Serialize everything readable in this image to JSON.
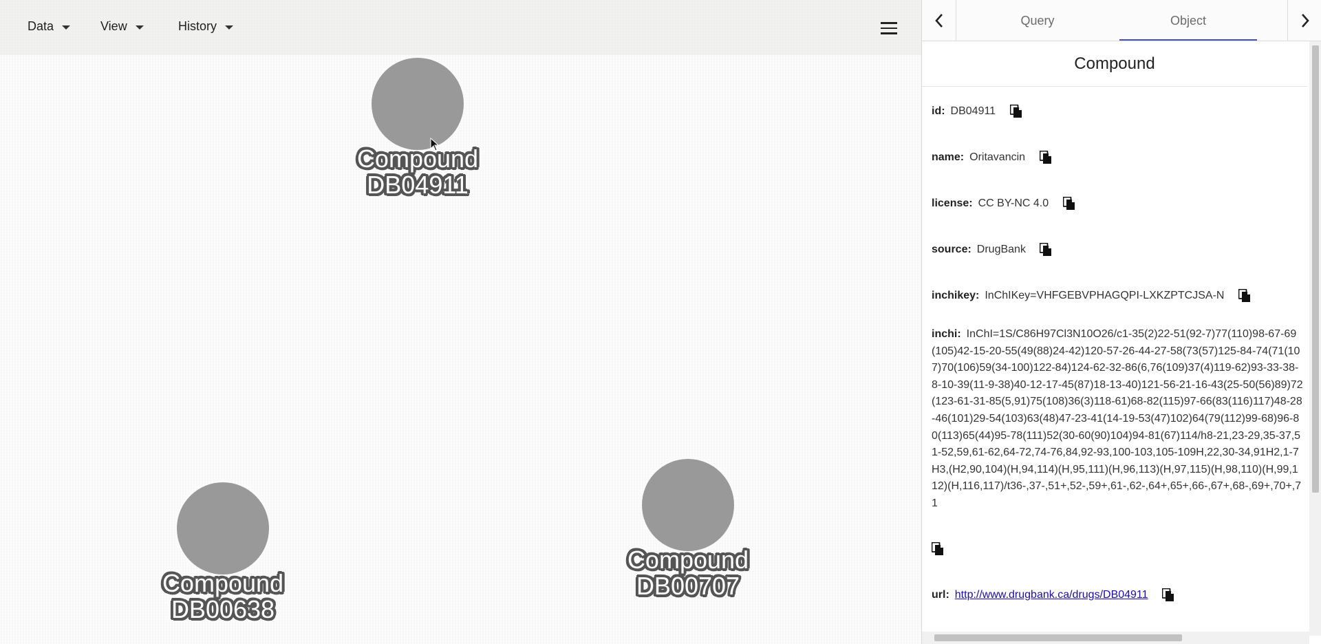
{
  "menu": {
    "data_label": "Data",
    "view_label": "View",
    "history_label": "History"
  },
  "nodes": [
    {
      "type_label": "Compound",
      "id_label": "DB04911"
    },
    {
      "type_label": "Compound",
      "id_label": "DB00638"
    },
    {
      "type_label": "Compound",
      "id_label": "DB00707"
    }
  ],
  "tabs": {
    "query_label": "Query",
    "object_label": "Object"
  },
  "object": {
    "title": "Compound",
    "props": {
      "id": {
        "key": "id:",
        "value": "DB04911"
      },
      "name": {
        "key": "name:",
        "value": "Oritavancin"
      },
      "license": {
        "key": "license:",
        "value": "CC BY-NC 4.0"
      },
      "source": {
        "key": "source:",
        "value": "DrugBank"
      },
      "inchikey": {
        "key": "inchikey:",
        "value": "InChIKey=VHFGEBVPHAGQPI-LXKZPTCJSA-N"
      },
      "inchi": {
        "key": "inchi:",
        "value": "InChI=1S/C86H97Cl3N10O26/c1-35(2)22-51(92-7)77(110)98-67-69(105)42-15-20-55(49(88)24-42)120-57-26-44-27-58(73(57)125-84-74(71(107)70(106)59(34-100)122-84)124-62-32-86(6,76(109)37(4)119-62)93-33-38-8-10-39(11-9-38)40-12-17-45(87)18-13-40)121-56-21-16-43(25-50(56)89)72(123-61-31-85(5,91)75(108)36(3)118-61)68-82(115)97-66(83(116)117)48-28-46(101)29-54(103)63(48)47-23-41(14-19-53(47)102)64(79(112)99-68)96-80(113)65(44)95-78(111)52(30-60(90)104)94-81(67)114/h8-21,23-29,35-37,51-52,59,61-62,64-72,74-76,84,92-93,100-103,105-109H,22,30-34,91H2,1-7H3,(H2,90,104)(H,94,114)(H,95,111)(H,96,113)(H,97,115)(H,98,110)(H,99,112)(H,116,117)/t36-,37-,51+,52-,59+,61-,62-,64+,65+,66-,67+,68-,69+,70+,71"
      },
      "url": {
        "key": "url:",
        "value": "http://www.drugbank.ca/drugs/DB04911"
      }
    }
  },
  "icons": {
    "copy": "copy-icon",
    "prev": "chevron-left-icon",
    "next": "chevron-right-icon",
    "menu": "hamburger-menu-icon",
    "dropdown": "caret-down-icon"
  },
  "colors": {
    "node_fill": "#999999",
    "node_label_outline": "#555555",
    "active_tab_underline": "#3f51b5",
    "link": "#1a0dab"
  }
}
